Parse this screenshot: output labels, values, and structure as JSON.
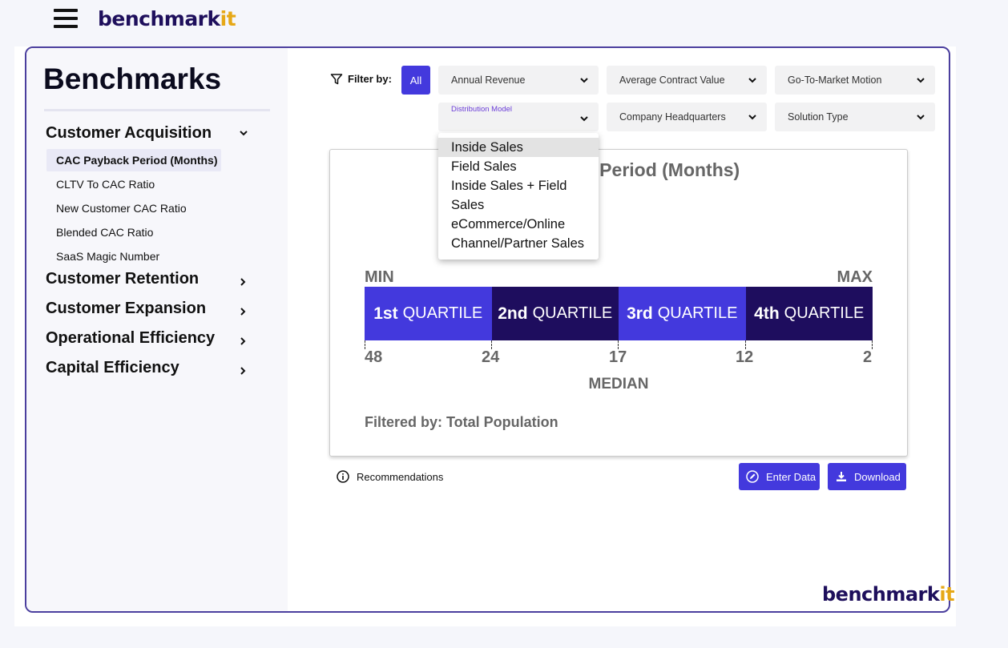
{
  "brand": {
    "logo_main": "benchmark",
    "logo_accent": "it"
  },
  "sidebar": {
    "title": "Benchmarks",
    "sections": [
      {
        "label": "Customer Acquisition",
        "chevron": "chevron-down-icon",
        "items": [
          {
            "label": "CAC Payback Period (Months)",
            "active": true
          },
          {
            "label": "CLTV To CAC Ratio"
          },
          {
            "label": "New Customer CAC Ratio"
          },
          {
            "label": "Blended CAC Ratio"
          },
          {
            "label": "SaaS Magic Number"
          }
        ]
      },
      {
        "label": "Customer Retention",
        "chevron": "chevron-right-icon"
      },
      {
        "label": "Customer Expansion",
        "chevron": "chevron-right-icon"
      },
      {
        "label": "Operational Efficiency",
        "chevron": "chevron-right-icon"
      },
      {
        "label": "Capital Efficiency",
        "chevron": "chevron-right-icon"
      }
    ]
  },
  "filters": {
    "label": "Filter by:",
    "all_label": "All",
    "dropdowns": [
      {
        "label": "Annual Revenue"
      },
      {
        "label": "Average Contract Value"
      },
      {
        "label": "Go-To-Market Motion"
      },
      {
        "label": "Distribution Model",
        "open": true
      },
      {
        "label": "Company Headquarters"
      },
      {
        "label": "Solution Type"
      }
    ],
    "menu_options": [
      "Inside Sales",
      "Field Sales",
      "Inside Sales + Field",
      "Sales",
      "eCommerce/Online",
      "Channel/Partner Sales"
    ]
  },
  "card": {
    "title_visible": "k Period (Months)",
    "min_label": "MIN",
    "max_label": "MAX",
    "quartiles": [
      {
        "ordinal": "1st",
        "word": "QUARTILE",
        "color": "#4339dd"
      },
      {
        "ordinal": "2nd",
        "word": "QUARTILE",
        "color": "#1e0d5e"
      },
      {
        "ordinal": "3rd",
        "word": "QUARTILE",
        "color": "#4339dd"
      },
      {
        "ordinal": "4th",
        "word": "QUARTILE",
        "color": "#1e0d5e"
      }
    ],
    "tick_values": [
      "48",
      "24",
      "17",
      "12",
      "2"
    ],
    "median_label": "MEDIAN",
    "filtered_by": "Filtered by: Total Population"
  },
  "actions": {
    "recommendations": "Recommendations",
    "enter_data": "Enter Data",
    "download": "Download"
  }
}
